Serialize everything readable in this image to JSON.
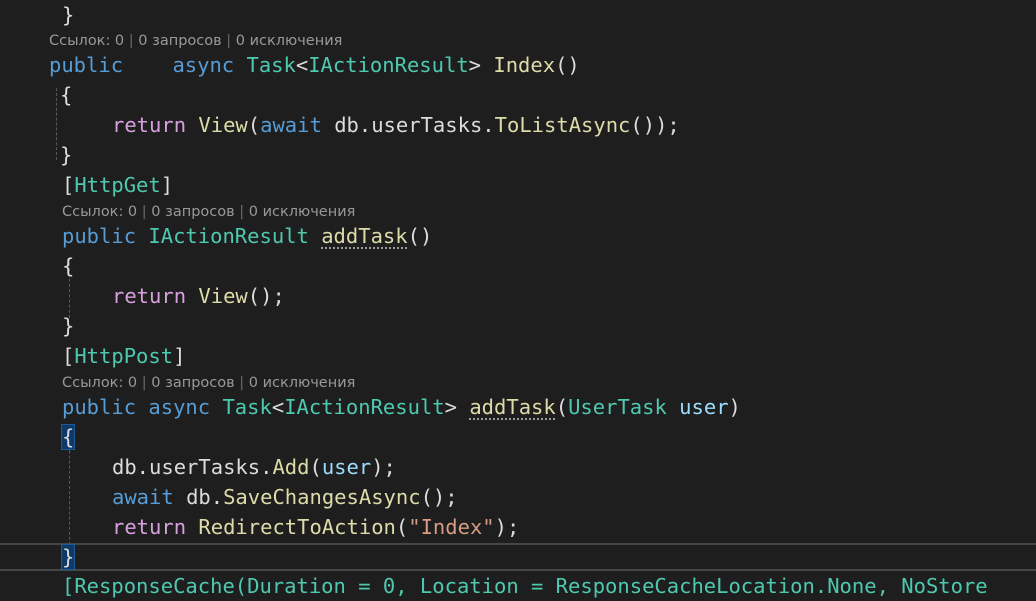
{
  "code": {
    "line_close_prev": "}",
    "lens_1": {
      "refs": "Ссылок: 0",
      "requests": "0 запросов",
      "exceptions": "0 исключения"
    },
    "index_sig": {
      "public": "public",
      "async": "async",
      "task": "Task",
      "lt": "<",
      "iar": "IActionResult",
      "gt": ">",
      "name": "Index",
      "parens": "()"
    },
    "index_open": "{",
    "index_return": {
      "return": "return",
      "view": "View",
      "lp": "(",
      "await": "await",
      "db": "db.userTasks.",
      "method": "ToListAsync",
      "tail": "());"
    },
    "index_close": "}",
    "attr_get": {
      "lb": "[",
      "name": "HttpGet",
      "rb": "]"
    },
    "lens_2": {
      "refs": "Ссылок: 0",
      "requests": "0 запросов",
      "exceptions": "0 исключения"
    },
    "addget_sig": {
      "public": "public",
      "iar": "IActionResult",
      "name": "addTask",
      "parens": "()"
    },
    "addget_open": "{",
    "addget_return": {
      "return": "return",
      "view": "View",
      "tail": "();"
    },
    "addget_close": "}",
    "attr_post": {
      "lb": "[",
      "name": "HttpPost",
      "rb": "]"
    },
    "lens_3": {
      "refs": "Ссылок: 0",
      "requests": "0 запросов",
      "exceptions": "0 исключения"
    },
    "addpost_sig": {
      "public": "public",
      "async": "async",
      "task": "Task",
      "lt": "<",
      "iar": "IActionResult",
      "gt": ">",
      "name": "addTask",
      "lp": "(",
      "ptype": "UserTask",
      "pname": "user",
      "rp": ")"
    },
    "addpost_open": "{",
    "addpost_add": {
      "db": "db.userTasks.",
      "method": "Add",
      "lp": "(",
      "arg": "user",
      "tail": ");"
    },
    "addpost_save": {
      "await": "await",
      "db": "db.",
      "method": "SaveChangesAsync",
      "tail": "();"
    },
    "addpost_return": {
      "return": "return",
      "method": "RedirectToAction",
      "lp": "(",
      "str": "\"Index\"",
      "tail": ");"
    },
    "addpost_close": "}",
    "cut_line": "[ResponseCache(Duration = 0, Location = ResponseCacheLocation.None, NoStore"
  },
  "colors": {
    "background": "#1e1e1e",
    "keyword": "#569cd6",
    "type": "#4ec9b0",
    "method": "#dcdcaa",
    "control": "#d8a0df",
    "parameter": "#9cdcfe",
    "string": "#d69d85",
    "codelens": "#999999"
  }
}
